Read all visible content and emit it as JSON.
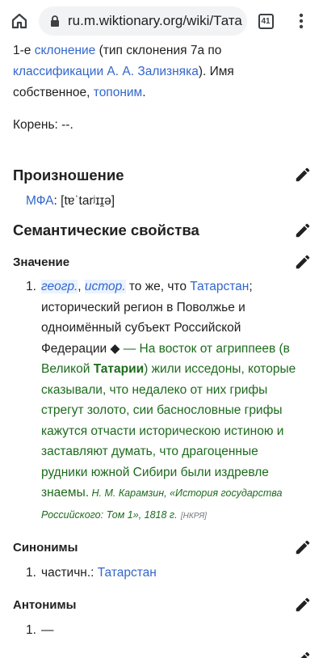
{
  "browser": {
    "url": "ru.m.wiktionary.org/wiki/Тата",
    "tab_count": "41"
  },
  "intro": {
    "line1_prefix": "1-е ",
    "line1_link": "склонение",
    "line1_suffix": " (тип склонения 7а по",
    "line2_link": "классификации А. А. Зализняка",
    "line2_suffix": "). Имя",
    "line3_prefix": "собственное, ",
    "line3_link": "топоним",
    "line3_suffix": ".",
    "root": "Корень: --."
  },
  "pronunciation": {
    "heading": "Произношение",
    "ipa_label": "МФА",
    "ipa_value": ": [tɐˈtarʲɪɪ̯ə]"
  },
  "semantic": {
    "heading": "Семантические свойства",
    "meaning_heading": "Значение",
    "item_num": "1.",
    "tag1": "геогр.",
    "tag_sep": ",",
    "tag2": "истор.",
    "def_prefix": " то же, что ",
    "def_link": "Татарстан",
    "def_rest": "; исторический регион в Поволжье и одноимённый субъект Российской Федерации ◆ ",
    "quote_pre": "— На восток от агриппеев (в Великой ",
    "quote_bold": "Татарии",
    "quote_post": ") жили исседоны, которые сказывали, что недалеко от них грифы стрегут золото, сии баснословные грифы кажутся отчасти историческою истиною и заставляют думать, что драгоценные рудники южной Сибири были издревле знаемы.",
    "cite": " Н. М. Карамзин, «История государства Российского: Том 1», 1818 г.",
    "nkrya": "[НКРЯ]"
  },
  "synonyms": {
    "heading": "Синонимы",
    "num": "1.",
    "prefix": "частичн.: ",
    "link": "Татарстан"
  },
  "antonyms": {
    "heading": "Антонимы",
    "num": "1.",
    "value": "—"
  }
}
